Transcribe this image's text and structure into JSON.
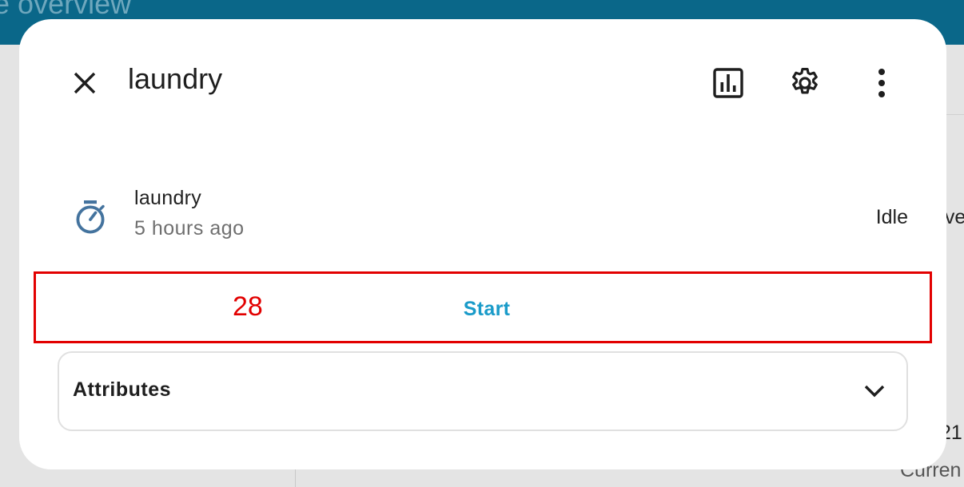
{
  "background": {
    "header_title": "de overview",
    "right_text_1": "ove",
    "right_text_2": "21",
    "right_text_3": "Curren"
  },
  "dialog": {
    "title": "laundry",
    "close_icon": "close-icon",
    "actions": [
      {
        "name": "history",
        "icon": "chart-box-icon"
      },
      {
        "name": "settings",
        "icon": "gear-icon"
      },
      {
        "name": "more",
        "icon": "dots-vertical-icon"
      }
    ],
    "entity": {
      "icon": "timer-outline-icon",
      "name": "laundry",
      "last_changed": "5 hours ago",
      "state": "Idle"
    },
    "controls": {
      "marker": "28",
      "start_label": "Start"
    },
    "attributes": {
      "label": "Attributes",
      "icon": "chevron-down-icon"
    }
  },
  "colors": {
    "header": "#0a6789",
    "accent": "#1a9bc9",
    "highlight": "#e20000",
    "timer_icon": "#44739e"
  }
}
